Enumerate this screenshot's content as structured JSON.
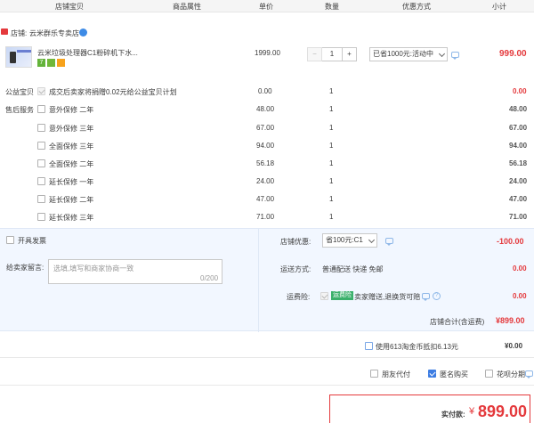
{
  "header": {
    "col_shop_item": "店铺宝贝",
    "col_props": "商品属性",
    "col_price": "单价",
    "col_qty": "数量",
    "col_discount": "优惠方式",
    "col_subtotal": "小计"
  },
  "shop": {
    "label": "店铺:",
    "name": "云米群乐专卖店"
  },
  "product": {
    "name": "云米垃圾处理器C1粉碎机下水...",
    "price": "1999.00",
    "quantity": "1",
    "minus": "−",
    "plus": "+",
    "discount_select": "已省1000元:活动中",
    "subtotal": "999.00",
    "badge_seven": "7",
    "thumb_text": "云米垃圾处理器"
  },
  "charity": {
    "label": "公益宝贝",
    "text": "成交后卖家将捐赠0.02元给公益宝贝计划",
    "price": "0.00",
    "qty": "1",
    "subtotal": "0.00"
  },
  "services": {
    "label": "售后服务",
    "items": [
      {
        "name": "意外保修 二年",
        "price": "48.00",
        "qty": "1",
        "subtotal": "48.00"
      },
      {
        "name": "意外保修 三年",
        "price": "67.00",
        "qty": "1",
        "subtotal": "67.00"
      },
      {
        "name": "全面保修 三年",
        "price": "94.00",
        "qty": "1",
        "subtotal": "94.00"
      },
      {
        "name": "全面保修 二年",
        "price": "56.18",
        "qty": "1",
        "subtotal": "56.18"
      },
      {
        "name": "延长保修 一年",
        "price": "24.00",
        "qty": "1",
        "subtotal": "24.00"
      },
      {
        "name": "延长保修 二年",
        "price": "47.00",
        "qty": "1",
        "subtotal": "47.00"
      },
      {
        "name": "延长保修 三年",
        "price": "71.00",
        "qty": "1",
        "subtotal": "71.00"
      }
    ]
  },
  "invoice": {
    "label": "开具发票"
  },
  "shop_coupon": {
    "label": "店铺优惠:",
    "value": "省100元:C1",
    "amount": "-100.00"
  },
  "message": {
    "label": "给卖家留言:",
    "placeholder": "选填,填写和商家协商一致",
    "counter": "0/200"
  },
  "delivery": {
    "label": "运送方式:",
    "value": "普通配送 快递 免邮",
    "amount": "0.00"
  },
  "shipping_insurance": {
    "label": "运费险:",
    "badge": "运费险",
    "text": "卖家赠送,退换货可赔",
    "amount": "0.00"
  },
  "shop_total": {
    "label": "店铺合计(含运费)",
    "amount": "¥899.00"
  },
  "coins": {
    "label": "使用613淘金币抵扣6.13元",
    "amount": "¥0.00"
  },
  "options": {
    "friend_pay": "朋友代付",
    "anonymous": "匿名购买",
    "installment": "花呗分期"
  },
  "payment": {
    "label": "实付款:",
    "currency": "¥",
    "amount": "899.00"
  },
  "colors": {
    "accent_red": "#e4393c",
    "header_bg": "#f5f5f5",
    "summary_bg": "#f2f7ff",
    "checkbox_blue": "#3d7de3"
  }
}
